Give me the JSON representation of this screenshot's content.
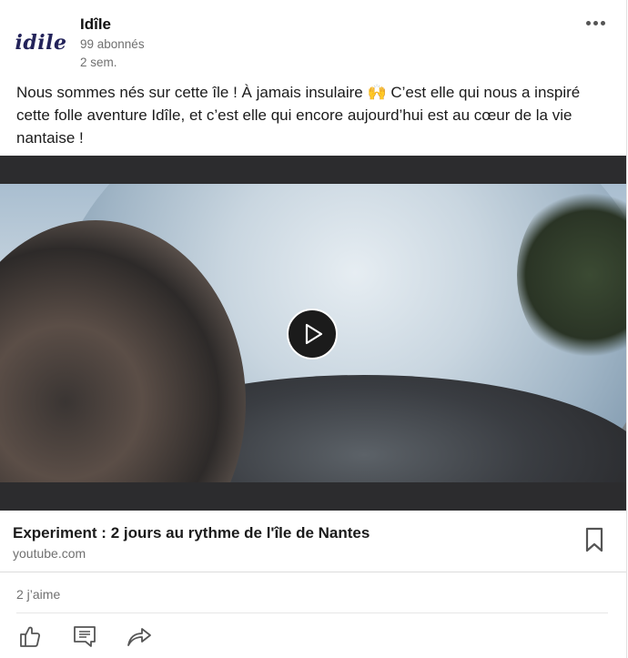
{
  "post": {
    "author_logo_text": "idile",
    "author": "Idîle",
    "followers": "99 abonnés",
    "time": "2 sem.",
    "text": "Nous sommes nés sur cette île ! À jamais insulaire 🙌 C’est elle qui nous a inspiré cette folle aventure Idîle, et c’est elle qui encore aujourd’hui est au cœur de la vie nantaise !"
  },
  "video": {
    "icon": "play-icon"
  },
  "link": {
    "title": "Experiment : 2 jours au rythme de l'île de Nantes",
    "source": "youtube.com",
    "bookmark_icon": "bookmark-icon"
  },
  "social": {
    "likes": "2 j’aime"
  },
  "actions": {
    "like_icon": "thumbs-up-icon",
    "comment_icon": "comment-icon",
    "share_icon": "share-icon"
  },
  "colors": {
    "text": "#1b1b1b",
    "muted": "#707070",
    "video_bg": "#2c2c2e",
    "logo": "#23235a"
  }
}
